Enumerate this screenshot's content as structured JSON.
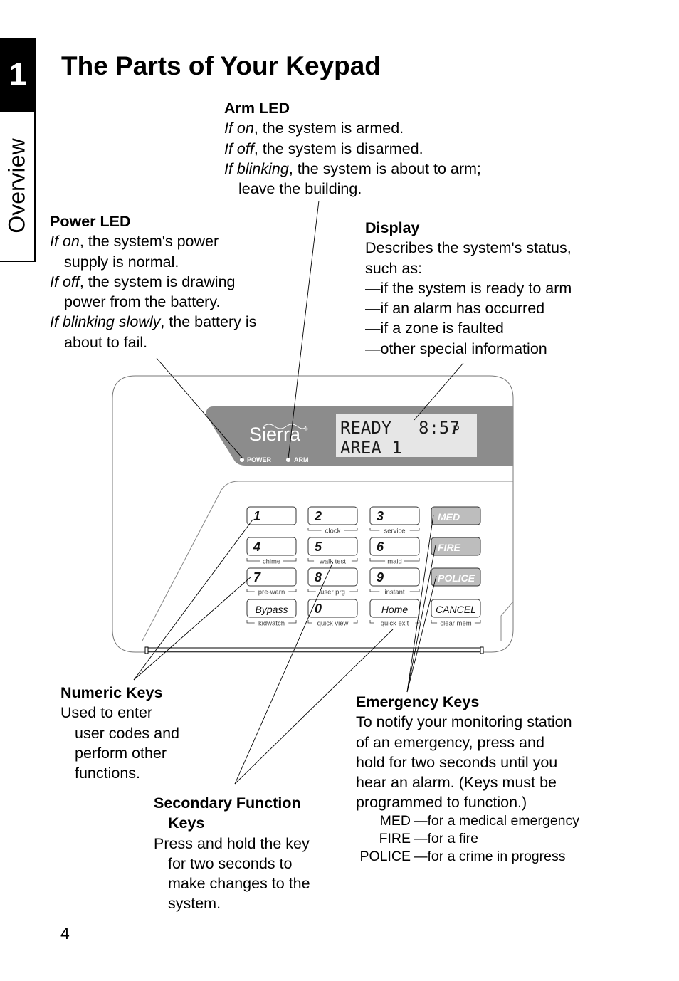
{
  "chapter": {
    "number": "1",
    "section": "Overview"
  },
  "page": {
    "title": "The Parts of Your Keypad",
    "number": "4"
  },
  "callouts": {
    "arm_led": {
      "heading": "Arm LED",
      "lines": [
        {
          "em": "If on",
          "rest": ", the system is armed."
        },
        {
          "em": "If off",
          "rest": ", the system is disarmed."
        },
        {
          "em": "If blinking",
          "rest": ", the system is about to arm;"
        }
      ],
      "continuation": "leave the building."
    },
    "power_led": {
      "heading": "Power LED",
      "l1_em": "If on",
      "l1_rest": ", the system's power",
      "l1_cont": "supply is normal.",
      "l2_em": "If off",
      "l2_rest": ", the system is drawing",
      "l2_cont": "power from the battery.",
      "l3_em": "If blinking slowly",
      "l3_rest": ", the battery is",
      "l3_cont": "about to fail."
    },
    "display": {
      "heading": "Display",
      "lines": [
        "Describes the system's status,",
        "such as:",
        "—if the system is ready to arm",
        "—if an alarm has occurred",
        "—if a zone is faulted",
        "—other special information"
      ]
    },
    "numeric_keys": {
      "heading": "Numeric Keys",
      "first": "Used to enter",
      "cont": [
        "user codes and",
        "perform other",
        "functions."
      ]
    },
    "secondary_keys": {
      "heading": "Secondary Function",
      "heading_cont": "Keys",
      "first": "Press and hold the key",
      "cont": [
        "for two seconds to",
        "make changes to the",
        "system."
      ]
    },
    "emergency_keys": {
      "heading": "Emergency Keys",
      "lines": [
        "To notify your monitoring station",
        "of an emergency, press and",
        "hold for two seconds until you",
        "hear an alarm. (Keys must be",
        "programmed to function.)"
      ],
      "table": [
        {
          "key": "MED",
          "desc": "—for a medical emergency"
        },
        {
          "key": "FIRE",
          "desc": "—for a fire"
        },
        {
          "key": "POLICE",
          "desc": "—for a crime in progress"
        }
      ]
    }
  },
  "keypad": {
    "brand": "Sierra",
    "trademark": "®",
    "led_labels": {
      "power": "POWER",
      "arm": "ARM"
    },
    "display": {
      "line1": "READY",
      "time": "8:57",
      "ampm": "P",
      "line2": "AREA 1"
    },
    "keys": [
      {
        "label": "1",
        "secondary": ""
      },
      {
        "label": "2",
        "secondary": "clock"
      },
      {
        "label": "3",
        "secondary": "service"
      },
      {
        "label": "MED",
        "secondary": ""
      },
      {
        "label": "4",
        "secondary": "chime"
      },
      {
        "label": "5",
        "secondary": "walk test"
      },
      {
        "label": "6",
        "secondary": "maid"
      },
      {
        "label": "FIRE",
        "secondary": ""
      },
      {
        "label": "7",
        "secondary": "pre-warn"
      },
      {
        "label": "8",
        "secondary": "user prg"
      },
      {
        "label": "9",
        "secondary": "instant"
      },
      {
        "label": "POLICE",
        "secondary": ""
      },
      {
        "label": "Bypass",
        "secondary": "kidwatch"
      },
      {
        "label": "0",
        "secondary": "quick view"
      },
      {
        "label": "Home",
        "secondary": "quick exit"
      },
      {
        "label": "CANCEL",
        "secondary": "clear mem"
      }
    ],
    "colors": {
      "panel": "#8c8c8c",
      "lcd": "#e6e6e6",
      "emergency_key": "#bdbdbd",
      "outline": "#555555"
    }
  }
}
